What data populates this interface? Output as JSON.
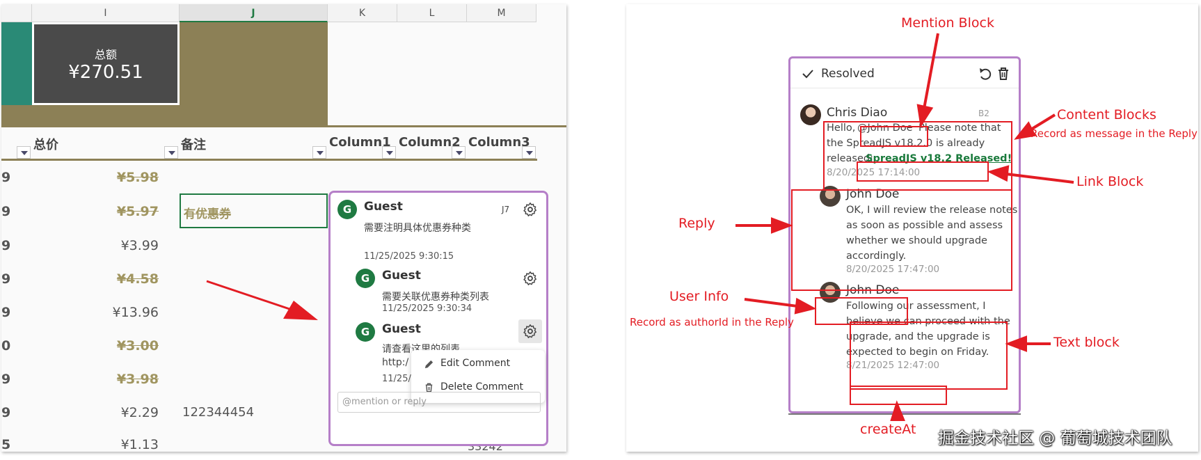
{
  "left": {
    "col_letters": [
      "I",
      "J",
      "K",
      "L",
      "M"
    ],
    "total_card": {
      "label": "总额",
      "value": "¥270.51"
    },
    "headers": {
      "total_price": "总价",
      "notes": "备注",
      "col1": "Column1",
      "col2": "Column2",
      "col3": "Column3"
    },
    "rows": [
      {
        "lead": "9",
        "price": "¥5.98",
        "struck": true,
        "note": ""
      },
      {
        "lead": "9",
        "price": "¥5.97",
        "struck": true,
        "note": "有优惠券"
      },
      {
        "lead": "9",
        "price": "¥3.99",
        "struck": false,
        "note": ""
      },
      {
        "lead": "9",
        "price": "¥4.58",
        "struck": true,
        "note": ""
      },
      {
        "lead": "9",
        "price": "¥13.96",
        "struck": false,
        "note": ""
      },
      {
        "lead": "0",
        "price": "¥3.00",
        "struck": true,
        "note": ""
      },
      {
        "lead": "9",
        "price": "¥3.98",
        "struck": true,
        "note": ""
      },
      {
        "lead": "9",
        "price": "¥2.29",
        "struck": false,
        "note": "122344454"
      },
      {
        "lead": "5",
        "price": "¥1.13",
        "struck": false,
        "note": ""
      }
    ],
    "partial_m_value": "33242",
    "comment": {
      "main": {
        "avatar": "G",
        "author": "Guest",
        "cell_ref": "J7",
        "text": "需要注明具体优惠券种类",
        "time": "11/25/2025 9:30:15"
      },
      "replies": [
        {
          "avatar": "G",
          "author": "Guest",
          "text": "需要关联优惠券种类列表",
          "time": "11/25/2025 9:30:34"
        },
        {
          "avatar": "G",
          "author": "Guest",
          "text": "请查看这里的列表",
          "text2": "http:/",
          "time": "11/25/"
        }
      ],
      "menu": {
        "edit": "Edit Comment",
        "delete": "Delete Comment"
      },
      "reply_placeholder": "@mention or reply"
    }
  },
  "right": {
    "resolved": "Resolved",
    "thread": {
      "first": {
        "author": "Chris Diao",
        "cell_ref": "B2",
        "hello": "Hello,",
        "mention": "@John Doe",
        "text_a": "Please note that",
        "text_b": "the SpreadJS v18.2.0 is already",
        "text_c": "released:",
        "link": "SpreadJS v18.2 Released!",
        "time": "8/20/2025 17:14:00"
      },
      "reply1": {
        "author": "John Doe",
        "lines": [
          "OK, I will review the release notes",
          "as soon as possible and assess",
          "whether we should upgrade",
          "accordingly."
        ],
        "time": "8/20/2025 17:47:00"
      },
      "reply2": {
        "author": "John Doe",
        "lines": [
          "Following our assessment, I",
          "believe we can proceed with the",
          "upgrade, and the upgrade is",
          "expected to begin on Friday."
        ],
        "time": "8/21/2025 12:47:00"
      }
    },
    "annotations": {
      "mention_block": "Mention Block",
      "content_blocks": "Content Blocks",
      "content_sub": "Record as message in the Reply",
      "link_block": "Link Block",
      "reply": "Reply",
      "user_info": "User Info",
      "user_info_sub": "Record as authorId in the Reply",
      "text_block": "Text block",
      "create_at": "createAt"
    },
    "watermark": "掘金技术社区 @ 葡萄城技术团队"
  },
  "colors": {
    "accent_red": "#e31c23",
    "comment_border": "#b57fc8",
    "olive": "#8c8056",
    "teal": "#2a8a76",
    "dark_card": "#4a4a4a",
    "avatar_green": "#1f7a42",
    "link_green": "#1a7a3c"
  }
}
